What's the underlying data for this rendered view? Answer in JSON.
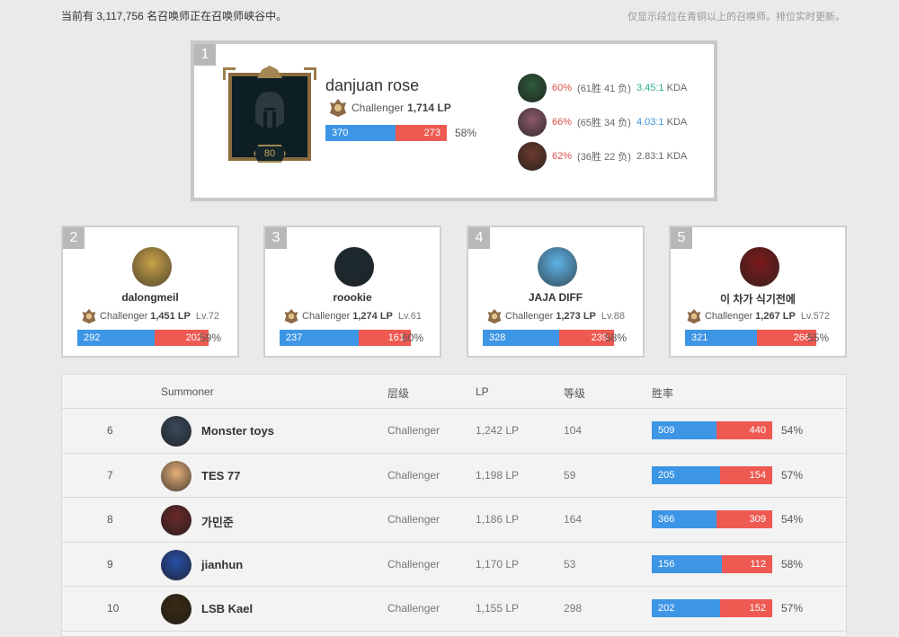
{
  "header": {
    "online_text": "当前有 3,117,756 名召唤师正在召唤师峡谷中。",
    "note_text": "仅显示段位在青铜以上的召唤师。排位实时更新。"
  },
  "top1": {
    "rank": "1",
    "name": "danjuan rose",
    "tier": "Challenger",
    "lp": "1,714 LP",
    "level": "80",
    "wins": "370",
    "losses": "273",
    "win_fraction": 0.575,
    "winrate": "58%",
    "champions": [
      {
        "winrate": "60%",
        "record": "(61胜 41 负)",
        "kda": "3.45:1",
        "kda_unit": "KDA",
        "kda_color": "teal",
        "avatar_color": "#2f5a3b"
      },
      {
        "winrate": "66%",
        "record": "(65胜 34 负)",
        "kda": "4.03:1",
        "kda_unit": "KDA",
        "kda_color": "blue",
        "avatar_color": "#8c5a6a"
      },
      {
        "winrate": "62%",
        "record": "(36胜 22 负)",
        "kda": "2.83:1",
        "kda_unit": "KDA",
        "kda_color": "gray",
        "avatar_color": "#6b3b2e"
      }
    ]
  },
  "cards": [
    {
      "rank": "2",
      "name": "dalongmeil",
      "tier": "Challenger",
      "lp": "1,451 LP",
      "level": "Lv.72",
      "wins": "292",
      "losses": "202",
      "win_fraction": 0.59,
      "winrate": "59%",
      "avatar_color": "#c9a24a",
      "avatar_icon": "pyramid-icon"
    },
    {
      "rank": "3",
      "name": "roookie",
      "tier": "Challenger",
      "lp": "1,274 LP",
      "level": "Lv.61",
      "wins": "237",
      "losses": "161",
      "win_fraction": 0.6,
      "winrate": "60%",
      "avatar_color": "#1b2a31",
      "avatar_icon": "helmet-icon"
    },
    {
      "rank": "4",
      "name": "JAJA DIFF",
      "tier": "Challenger",
      "lp": "1,273 LP",
      "level": "Lv.88",
      "wins": "328",
      "losses": "239",
      "win_fraction": 0.58,
      "winrate": "58%",
      "avatar_color": "#5fb2e6",
      "avatar_icon": "duck-icon"
    },
    {
      "rank": "5",
      "name": "이 차가 식기전에",
      "tier": "Challenger",
      "lp": "1,267 LP",
      "level": "Lv.572",
      "wins": "321",
      "losses": "266",
      "win_fraction": 0.55,
      "winrate": "55%",
      "avatar_color": "#7a1a1a",
      "avatar_icon": "demon-icon"
    }
  ],
  "table": {
    "headers": {
      "summoner": "Summoner",
      "tier": "层级",
      "lp": "LP",
      "level": "等级",
      "winrate": "胜率"
    },
    "rows": [
      {
        "rank": "6",
        "name": "Monster toys",
        "tier": "Challenger",
        "lp": "1,242 LP",
        "level": "104",
        "wins": "509",
        "losses": "440",
        "win_fraction": 0.54,
        "winrate": "54%",
        "avatar_color": "#3b4a5c"
      },
      {
        "rank": "7",
        "name": "TES 77",
        "tier": "Challenger",
        "lp": "1,198 LP",
        "level": "59",
        "wins": "205",
        "losses": "154",
        "win_fraction": 0.57,
        "winrate": "57%",
        "avatar_color": "#e5b07a"
      },
      {
        "rank": "8",
        "name": "가민준",
        "tier": "Challenger",
        "lp": "1,186 LP",
        "level": "164",
        "wins": "366",
        "losses": "309",
        "win_fraction": 0.54,
        "winrate": "54%",
        "avatar_color": "#6a2a2a"
      },
      {
        "rank": "9",
        "name": "jianhun",
        "tier": "Challenger",
        "lp": "1,170 LP",
        "level": "53",
        "wins": "156",
        "losses": "112",
        "win_fraction": 0.58,
        "winrate": "58%",
        "avatar_color": "#2a4fa8"
      },
      {
        "rank": "10",
        "name": "LSB Kael",
        "tier": "Challenger",
        "lp": "1,155 LP",
        "level": "298",
        "wins": "202",
        "losses": "152",
        "win_fraction": 0.57,
        "winrate": "57%",
        "avatar_color": "#3a2a14"
      }
    ]
  },
  "colors": {
    "win": "#3d95e5",
    "loss": "#ee5a52",
    "red_text": "#d6504a",
    "teal": "#2daf94",
    "blue": "#3d8fd6"
  }
}
